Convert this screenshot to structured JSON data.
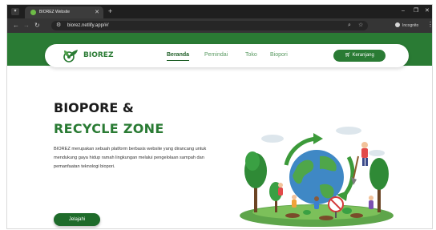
{
  "browser": {
    "tab_title": "BIOREZ Website",
    "url": "biorez.netlify.app/#/",
    "incognito_label": "Incognito",
    "icons": [
      "tab-menu-icon",
      "favicon-icon",
      "close-tab-icon",
      "new-tab-icon",
      "minimize-icon",
      "maximize-icon",
      "close-window-icon",
      "back-icon",
      "forward-icon",
      "reload-icon",
      "site-info-icon",
      "zoom-icon",
      "bookmark-star-icon",
      "incognito-icon",
      "menu-kebab-icon"
    ]
  },
  "nav": {
    "brand": "BIOREZ",
    "links": [
      {
        "label": "Beranda",
        "active": true
      },
      {
        "label": "Pemindai",
        "active": false
      },
      {
        "label": "Toko",
        "active": false
      },
      {
        "label": "Biopori",
        "active": false
      }
    ],
    "cart_label": "Keranjang"
  },
  "hero": {
    "title_line1": "BIOPORE &",
    "title_line2": "RECYCLE ZONE",
    "description": "BIOREZ merupakan sebuah platform berbasis website yang dirancang untuk mendukung gaya hidup ramah lingkungan melalui pengelolaan sampah dan pemanfaatan teknologi biopori.",
    "cta_label": "Jelajahi"
  },
  "colors": {
    "brand_green": "#2a7b34",
    "dark_green": "#1e6b2a",
    "browser_dark": "#1f1f1f"
  }
}
